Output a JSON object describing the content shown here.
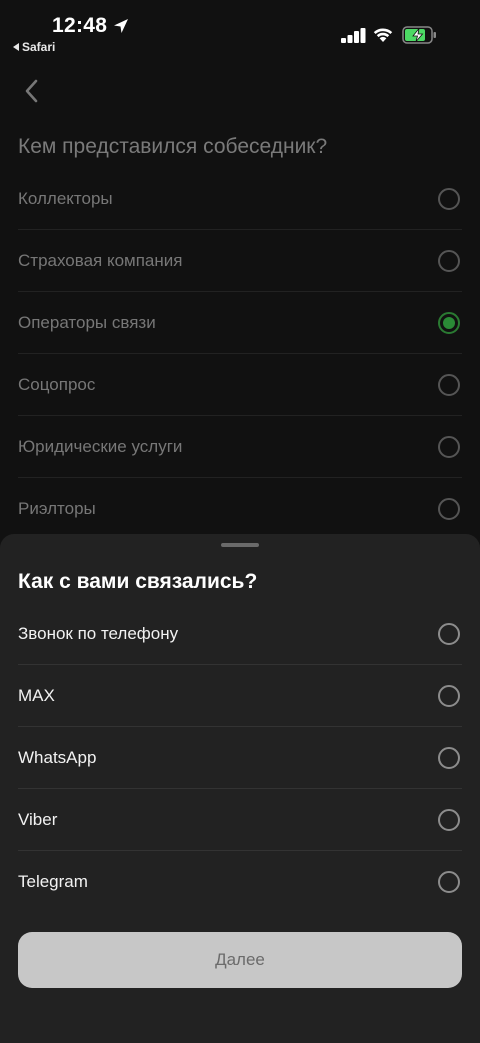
{
  "status_bar": {
    "time": "12:48",
    "back_app": "Safari"
  },
  "page": {
    "title": "Кем представился собеседник?",
    "options": [
      {
        "label": "Коллекторы",
        "checked": false
      },
      {
        "label": "Страховая компания",
        "checked": false
      },
      {
        "label": "Операторы связи",
        "checked": true
      },
      {
        "label": "Соцопрос",
        "checked": false
      },
      {
        "label": "Юридические услуги",
        "checked": false
      },
      {
        "label": "Риэлторы",
        "checked": false
      }
    ]
  },
  "sheet": {
    "title": "Как с вами связались?",
    "options": [
      {
        "label": "Звонок по телефону",
        "checked": false
      },
      {
        "label": "MAX",
        "checked": false
      },
      {
        "label": "WhatsApp",
        "checked": false
      },
      {
        "label": "Viber",
        "checked": false
      },
      {
        "label": "Telegram",
        "checked": false
      }
    ],
    "next_label": "Далее"
  },
  "colors": {
    "accent_green": "#2a8a36",
    "sheet_bg": "#222222",
    "button_disabled": "#c7c7c7"
  }
}
